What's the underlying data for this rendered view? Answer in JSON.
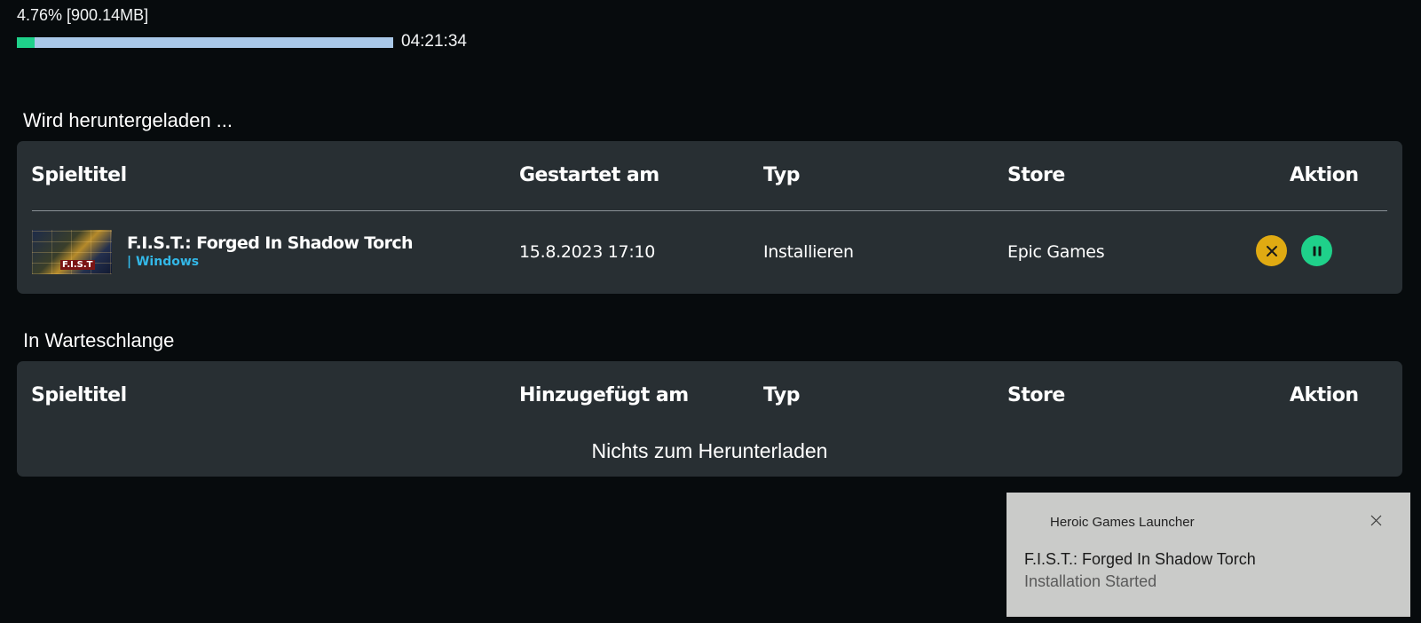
{
  "progress": {
    "text": "4.76% [900.14MB]",
    "percent": 4.76,
    "eta": "04:21:34",
    "fill_color": "#1fd18a",
    "track_color": "#a9c8e8"
  },
  "downloading": {
    "title": "Wird heruntergeladen ...",
    "headers": {
      "title": "Spieltitel",
      "started": "Gestartet am",
      "type": "Typ",
      "store": "Store",
      "action": "Aktion"
    },
    "item": {
      "name": "F.I.S.T.: Forged In Shadow Torch",
      "platform": "| Windows",
      "thumbnail_logo": "F.I.S.T",
      "started": "15.8.2023 17:10",
      "type": "Installieren",
      "store": "Epic Games",
      "actions": [
        {
          "icon": "close-icon",
          "color": "#e0aa12"
        },
        {
          "icon": "pause-icon",
          "color": "#1fd18a"
        }
      ]
    }
  },
  "queue": {
    "title": "In Warteschlange",
    "headers": {
      "title": "Spieltitel",
      "added": "Hinzugefügt am",
      "type": "Typ",
      "store": "Store",
      "action": "Aktion"
    },
    "empty_message": "Nichts zum Herunterladen"
  },
  "notification": {
    "app_name": "Heroic Games Launcher",
    "title": "F.I.S.T.: Forged In Shadow Torch",
    "body": "Installation Started",
    "background": "#cacbc9"
  }
}
